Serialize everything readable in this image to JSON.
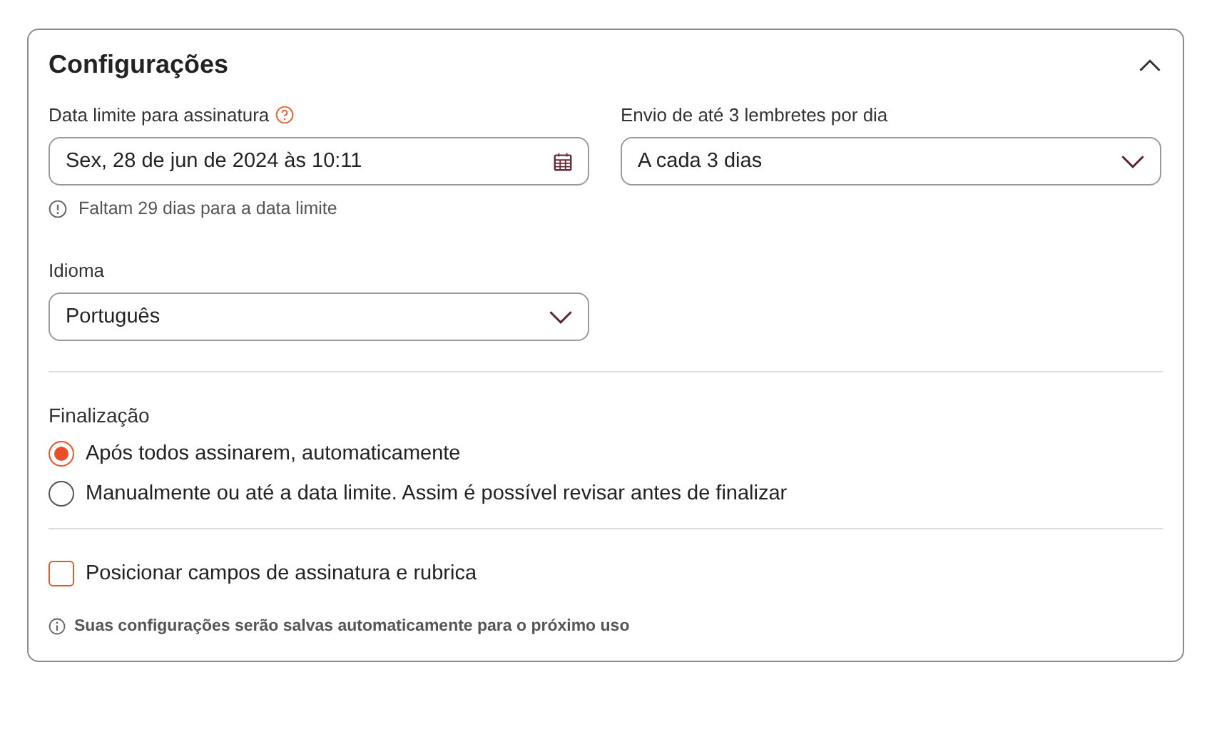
{
  "panel": {
    "title": "Configurações",
    "expanded": true
  },
  "fields": [
    {
      "label": "Data limite para assinatura",
      "kind": "date",
      "help": true,
      "value": "Sex, 28 de jun de 2024 às 10:11",
      "hint": "Faltam 29 dias para a data limite"
    },
    {
      "label": "Envio de até 3 lembretes por dia",
      "kind": "select",
      "help": false,
      "value": "A cada 3 dias"
    },
    {
      "label": "Idioma",
      "kind": "select",
      "help": false,
      "value": "Português"
    }
  ],
  "finalization": {
    "label": "Finalização",
    "options": [
      {
        "label": "Após todos assinarem, automaticamente",
        "selected": true
      },
      {
        "label": "Manualmente ou até a data limite. Assim é possível revisar antes de finalizar",
        "selected": false
      }
    ]
  },
  "checkbox": {
    "label": "Posicionar campos de assinatura e rubrica",
    "checked": false
  },
  "note": "Suas configurações serão salvas automaticamente para o próximo uso"
}
